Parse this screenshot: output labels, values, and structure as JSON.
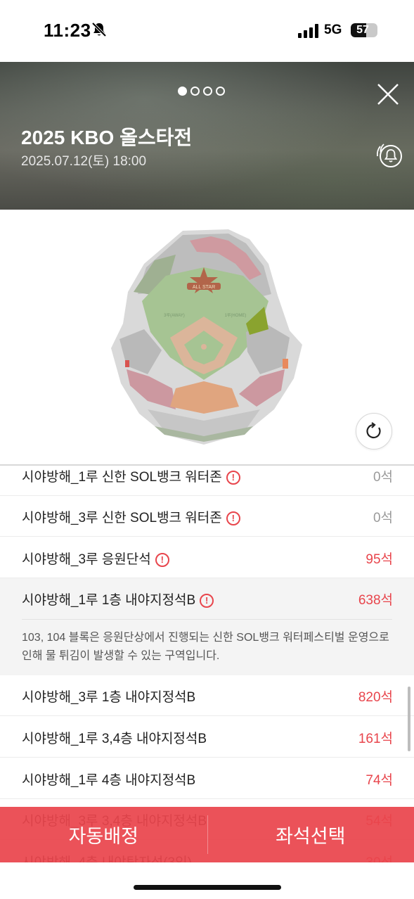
{
  "status_bar": {
    "time": "11:23",
    "network": "5G",
    "battery": "57",
    "battery_level": 0.57,
    "icons": [
      "bell-slash-icon",
      "signal-icon"
    ]
  },
  "header": {
    "pager": {
      "pages": 4,
      "active_index": 0
    },
    "title": "2025 KBO 올스타전",
    "datetime": "2025.07.12(토) 18:00",
    "close_icon": "close-icon",
    "alarm_icon": "alarm-bell-icon"
  },
  "map": {
    "refresh_icon": "refresh-icon",
    "colors": {
      "outfield": "#9fbf8c",
      "infield_dirt": "#d9b59a",
      "gray_section": "#b8b8b8",
      "pink_section": "#cf9aa0",
      "highlight": "#8aa32f",
      "orange_section": "#e0a57f"
    }
  },
  "seat_list": {
    "rows": [
      {
        "name": "시야방해_1루 신한 SOL뱅크 워터존",
        "count": "0석",
        "has_info": true,
        "available": false
      },
      {
        "name": "시야방해_3루 신한 SOL뱅크 워터존",
        "count": "0석",
        "has_info": true,
        "available": false
      },
      {
        "name": "시야방해_3루 응원단석",
        "count": "95석",
        "has_info": true,
        "available": true
      },
      {
        "name": "시야방해_1루 1층 내야지정석B",
        "count": "638석",
        "has_info": true,
        "available": true,
        "expanded": true
      },
      {
        "name": "시야방해_3루 1층 내야지정석B",
        "count": "820석",
        "has_info": false,
        "available": true
      },
      {
        "name": "시야방해_1루 3,4층 내야지정석B",
        "count": "161석",
        "has_info": false,
        "available": true
      },
      {
        "name": "시야방해_1루 4층 내야지정석B",
        "count": "74석",
        "has_info": false,
        "available": true
      },
      {
        "name": "시야방해_3루 3,4층 내야지정석B",
        "count": "54석",
        "has_info": false,
        "available": true
      },
      {
        "name": "시야방해_4층 내야탁자석(3인)",
        "count": "30석",
        "has_info": false,
        "available": true
      }
    ],
    "detail_text": "103, 104 블록은 응원단상에서 진행되는 신한 SOL뱅크 워터페스티벌 운영으로 인해 물 튀김이 발생할 수 있는 구역입니다."
  },
  "bottom_bar": {
    "auto_assign": "자동배정",
    "select_seat": "좌석선택"
  }
}
